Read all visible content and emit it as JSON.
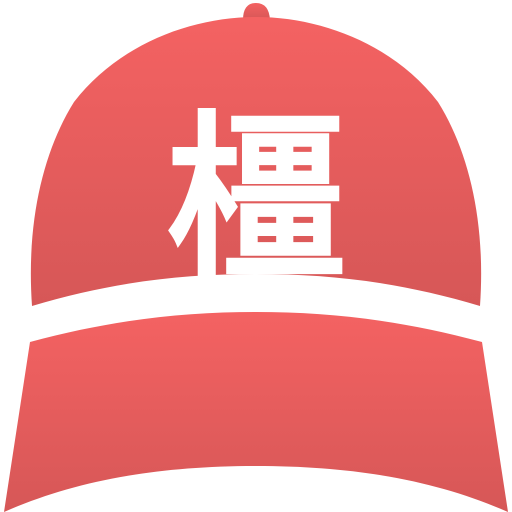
{
  "cap": {
    "label": "橿",
    "colors": {
      "top": "#f46262",
      "bottom": "#d65757",
      "band": "#ffffff",
      "label": "#ffffff"
    }
  }
}
